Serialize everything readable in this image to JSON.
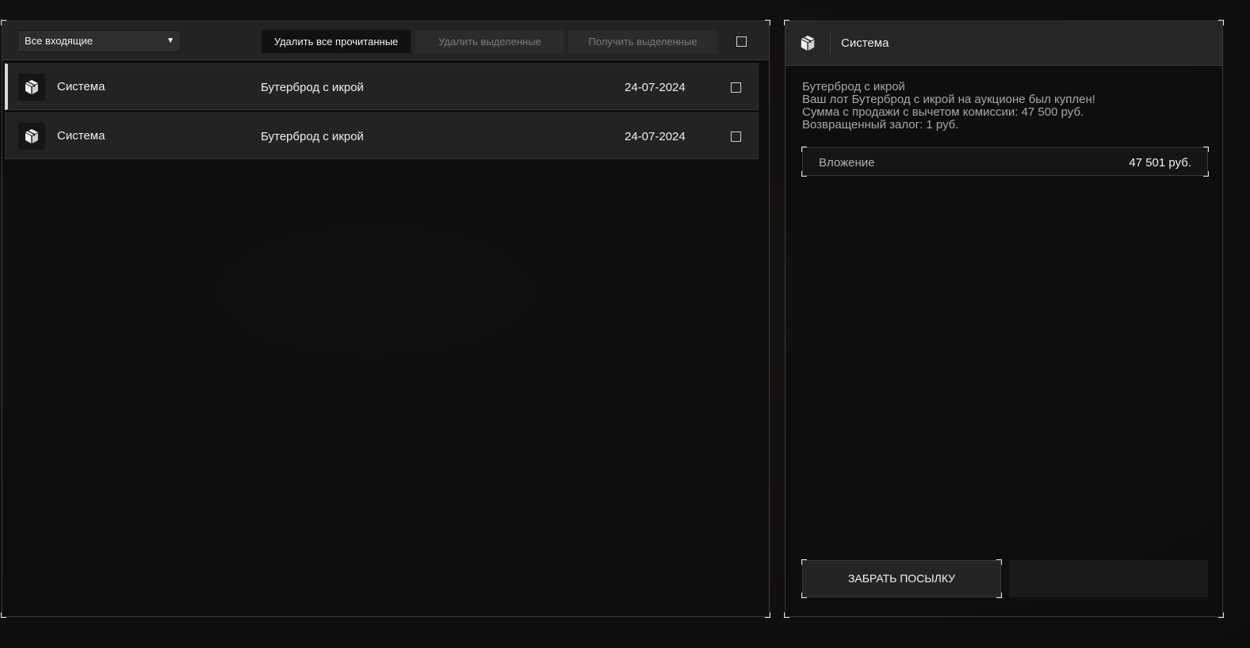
{
  "inbox": {
    "filter": {
      "selected": "Все входящие",
      "arrow": "▼"
    },
    "buttons": {
      "delete_read": "Удалить все прочитанные",
      "delete_selected": "Удалить выделенные",
      "get_selected": "Получить выделенные"
    },
    "messages": [
      {
        "sender": "Система",
        "subject": "Бутерброд с икрой",
        "date": "24-07-2024",
        "selected": true,
        "icon": "package-icon"
      },
      {
        "sender": "Система",
        "subject": "Бутерброд с икрой",
        "date": "24-07-2024",
        "selected": false,
        "icon": "package-icon"
      }
    ]
  },
  "detail": {
    "sender": "Система",
    "icon": "package-icon",
    "body_lines": [
      "Бутерброд с икрой",
      "Ваш лот Бутерброд с икрой на аукционе был куплен!",
      "Сумма с продажи с вычетом комиссии: 47 500 руб.",
      "Возвращенный залог: 1 руб."
    ],
    "attachment": {
      "label": "Вложение",
      "value": "47 501 руб."
    },
    "claim_button": "ЗАБРАТЬ ПОСЫЛКУ"
  }
}
